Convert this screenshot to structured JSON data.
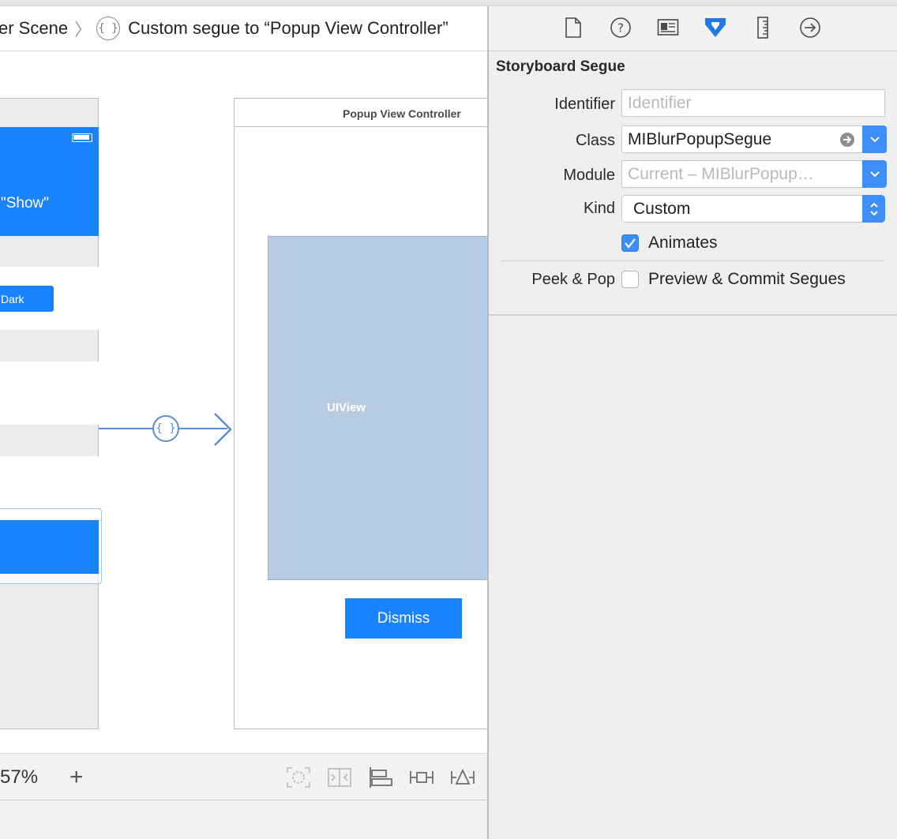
{
  "breadcrumb": {
    "parent": "er Scene",
    "current": "Custom segue to “Popup View Controller”"
  },
  "left_scene": {
    "show_text": "\"Show\"",
    "dark_button": "Dark"
  },
  "segue": {
    "icon_glyph": "{ }"
  },
  "popup_scene": {
    "title": "Popup View Controller",
    "uiview_label": "UIView",
    "dismiss_button": "Dismiss"
  },
  "bottom_bar": {
    "zoom": "57%",
    "zoom_in": "+"
  },
  "inspector": {
    "tabs": [
      "file-inspector-icon",
      "quick-help-icon",
      "identity-inspector-icon",
      "attributes-inspector-icon",
      "size-inspector-icon",
      "connections-inspector-icon"
    ],
    "active_tab": "attributes-inspector-icon",
    "section_title": "Storyboard Segue",
    "identifier": {
      "label": "Identifier",
      "value": "",
      "placeholder": "Identifier"
    },
    "class": {
      "label": "Class",
      "value": "MIBlurPopupSegue"
    },
    "module": {
      "label": "Module",
      "placeholder": "Current – MIBlurPopup…"
    },
    "kind": {
      "label": "Kind",
      "value": "Custom"
    },
    "animates": {
      "label": "Animates",
      "checked": true
    },
    "peek_pop": {
      "label": "Peek & Pop",
      "option": "Preview & Commit Segues",
      "checked": false
    }
  },
  "colors": {
    "accent": "#1a82fb",
    "control_blue": "#3d8ef8",
    "uiview_fill": "#b7cbe2",
    "segue_line": "#5b8fd2"
  }
}
